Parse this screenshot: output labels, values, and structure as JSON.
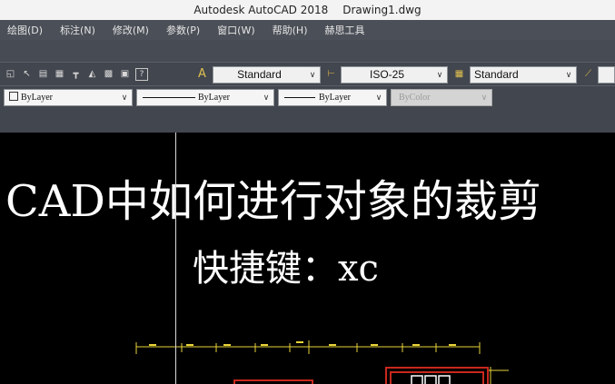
{
  "window": {
    "app_title": "Autodesk AutoCAD 2018",
    "file_name": "Drawing1.dwg"
  },
  "menu": [
    "绘图(D)",
    "标注(N)",
    "修改(M)",
    "参数(P)",
    "窗口(W)",
    "帮助(H)",
    "赫思工具"
  ],
  "toolbar": {
    "text_style": "Standard",
    "dim_style": "ISO-25",
    "table_style": "Standard"
  },
  "properties": {
    "color": "ByLayer",
    "linetype": "ByLayer",
    "lineweight": "ByLayer",
    "plot_style": "ByColor"
  },
  "canvas": {
    "heading_line1": "CAD中如何进行对象的裁剪",
    "heading_line2": "快捷键：xc"
  },
  "colors": {
    "accent_yellow": "#e9d43a",
    "accent_red": "#c8281e"
  }
}
